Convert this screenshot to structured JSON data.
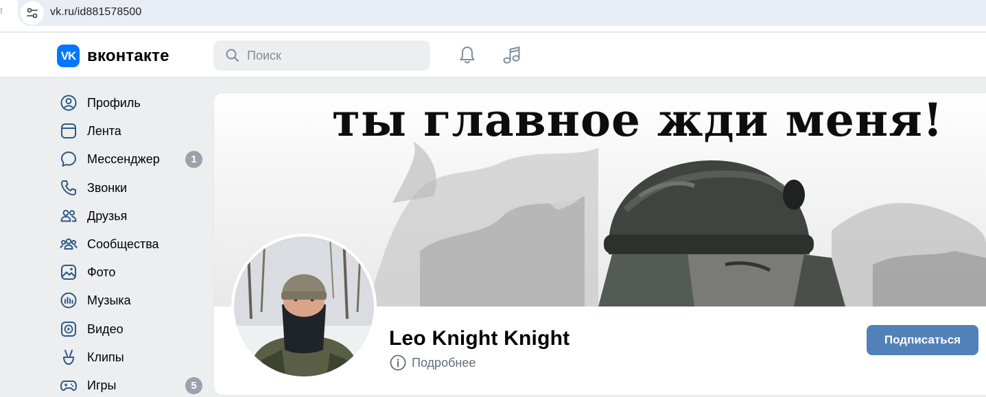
{
  "browser": {
    "url": "vk.ru/id881578500"
  },
  "header": {
    "logo_mark": "VK",
    "wordmark": "вконтакте",
    "search_placeholder": "Поиск",
    "brand_color": "#0077ff"
  },
  "sidebar": {
    "items": [
      {
        "label": "Профиль",
        "icon": "user-circle-icon",
        "badge": ""
      },
      {
        "label": "Лента",
        "icon": "newsfeed-icon",
        "badge": ""
      },
      {
        "label": "Мессенджер",
        "icon": "message-icon",
        "badge": "1"
      },
      {
        "label": "Звонки",
        "icon": "phone-icon",
        "badge": ""
      },
      {
        "label": "Друзья",
        "icon": "friends-icon",
        "badge": ""
      },
      {
        "label": "Сообщества",
        "icon": "communities-icon",
        "badge": ""
      },
      {
        "label": "Фото",
        "icon": "photo-icon",
        "badge": ""
      },
      {
        "label": "Музыка",
        "icon": "music-icon",
        "badge": ""
      },
      {
        "label": "Видео",
        "icon": "video-icon",
        "badge": ""
      },
      {
        "label": "Клипы",
        "icon": "clips-icon",
        "badge": ""
      },
      {
        "label": "Игры",
        "icon": "games-icon",
        "badge": "5"
      }
    ]
  },
  "profile": {
    "cover_text": "ты главное жди меня!",
    "name": "Leo Knight Knight",
    "more_label": "Подробнее",
    "subscribe_label": "Подписаться",
    "subscribe_color": "#5181b8"
  }
}
